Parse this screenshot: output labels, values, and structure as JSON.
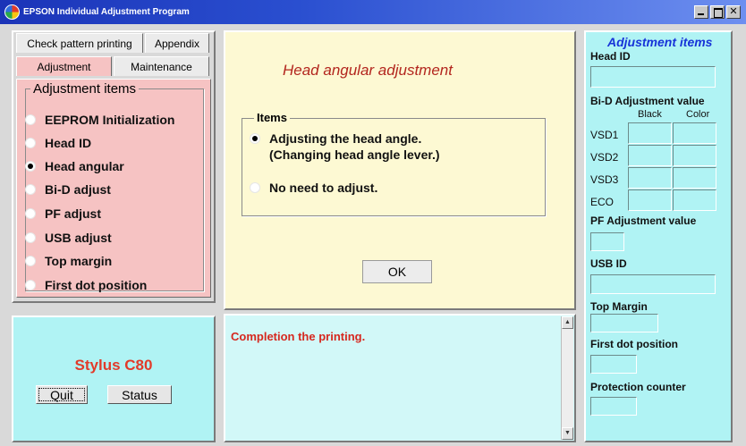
{
  "window": {
    "title": "EPSON Individual Adjustment Program",
    "icon": "epson-logo-icon",
    "controls": {
      "minimize": "",
      "maximize": "",
      "close": "✕"
    }
  },
  "tabs": {
    "row1": [
      "Check pattern printing",
      "Appendix"
    ],
    "row2": [
      "Adjustment",
      "Maintenance"
    ],
    "active": "Adjustment"
  },
  "adjustment_items": {
    "title": "Adjustment items",
    "items": [
      {
        "label": "EEPROM Initialization",
        "selected": false
      },
      {
        "label": "Head ID",
        "selected": false
      },
      {
        "label": "Head angular",
        "selected": true
      },
      {
        "label": "Bi-D adjust",
        "selected": false
      },
      {
        "label": "PF adjust",
        "selected": false
      },
      {
        "label": "USB adjust",
        "selected": false
      },
      {
        "label": "Top margin",
        "selected": false
      },
      {
        "label": "First dot position",
        "selected": false
      }
    ]
  },
  "main": {
    "heading": "Head angular adjustment",
    "items_group_title": "Items",
    "options": [
      {
        "line1": "Adjusting the head angle.",
        "line2": "(Changing head angle lever.)",
        "selected": true
      },
      {
        "line1": "No need to adjust.",
        "line2": "",
        "selected": false
      }
    ],
    "ok_label": "OK"
  },
  "model": {
    "name": "Stylus C80",
    "quit_label": "Quit",
    "status_label": "Status"
  },
  "message": {
    "text": "Completion the printing."
  },
  "right_panel": {
    "title": "Adjustment items",
    "head_id_label": "Head ID",
    "bid_label": "Bi-D Adjustment value",
    "bid_columns": [
      "Black",
      "Color"
    ],
    "bid_rows": [
      "VSD1",
      "VSD2",
      "VSD3",
      "ECO"
    ],
    "pf_label": "PF Adjustment value",
    "usb_label": "USB ID",
    "top_margin_label": "Top Margin",
    "first_dot_label": "First dot position",
    "protection_label": "Protection counter"
  },
  "colors": {
    "titlebar": "#1b34b8",
    "tab_body": "#f6c3c3",
    "main_panel": "#fdf9d3",
    "cyan_panel": "#b0f3f4",
    "accent_red": "#e23b2a",
    "accent_blue": "#1733d8"
  }
}
